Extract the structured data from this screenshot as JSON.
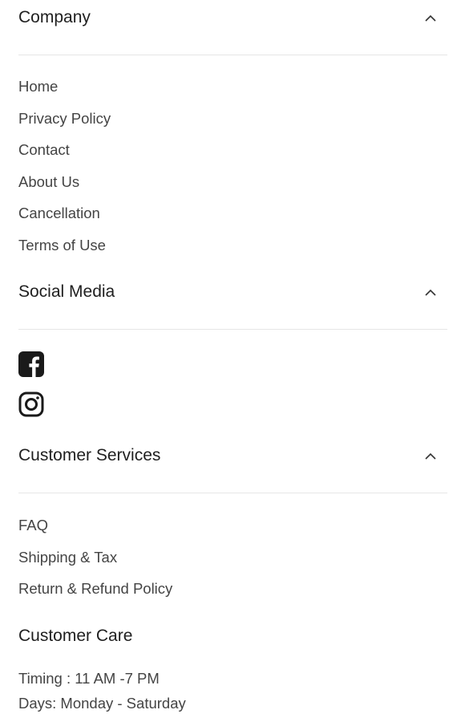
{
  "company": {
    "title": "Company",
    "links": [
      "Home",
      "Privacy Policy",
      "Contact",
      "About Us",
      "Cancellation",
      "Terms of Use"
    ]
  },
  "social_media": {
    "title": "Social Media",
    "icons": [
      "facebook-icon",
      "instagram-icon"
    ]
  },
  "customer_services": {
    "title": "Customer Services",
    "links": [
      "FAQ",
      "Shipping & Tax",
      "Return & Refund Policy"
    ]
  },
  "customer_care": {
    "title": "Customer Care",
    "timing": "Timing : 11 AM -7 PM",
    "days": "Days: Monday - Saturday"
  },
  "colors": {
    "text": "#444444",
    "heading": "#1f1f1f",
    "divider": "#e6e6e6"
  }
}
